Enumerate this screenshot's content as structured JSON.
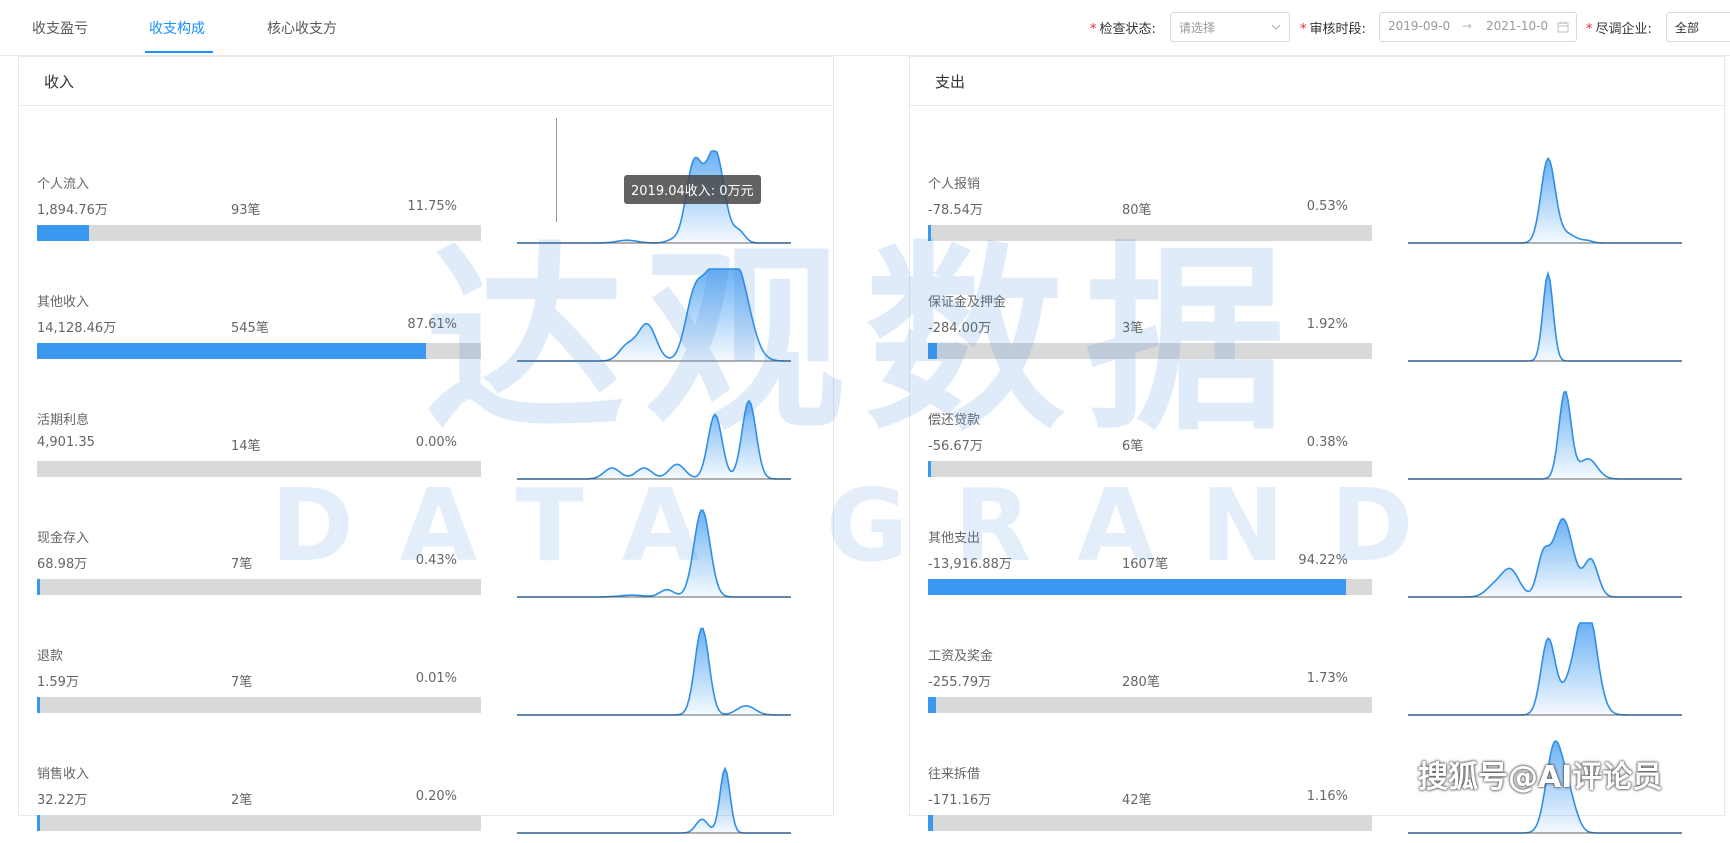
{
  "tabs": [
    {
      "label": "收支盈亏"
    },
    {
      "label": "收支构成"
    },
    {
      "label": "核心收支方"
    }
  ],
  "active_tab": 1,
  "filters": {
    "status_label": "检查状态:",
    "status_placeholder": "请选择",
    "period_label": "审核时段:",
    "date_start": "2019-09-0",
    "date_end": "2021-10-0",
    "date_separator": "→",
    "company_label": "尽调企业:",
    "company_value": "全部"
  },
  "income": {
    "title": "收入",
    "rows": [
      {
        "name": "个人流入",
        "amount": "1,894.76万",
        "count": "93笔",
        "percent": "11.75%",
        "ratio": 0.1175
      },
      {
        "name": "其他收入",
        "amount": "14,128.46万",
        "count": "545笔",
        "percent": "87.61%",
        "ratio": 0.8761
      },
      {
        "name": "活期利息",
        "amount": "4,901.35",
        "count": "14笔",
        "percent": "0.00%",
        "ratio": 0.0
      },
      {
        "name": "现金存入",
        "amount": "68.98万",
        "count": "7笔",
        "percent": "0.43%",
        "ratio": 0.0043
      },
      {
        "name": "退款",
        "amount": "1.59万",
        "count": "7笔",
        "percent": "0.01%",
        "ratio": 0.0001
      },
      {
        "name": "销售收入",
        "amount": "32.22万",
        "count": "2笔",
        "percent": "0.20%",
        "ratio": 0.002
      }
    ]
  },
  "expense": {
    "title": "支出",
    "rows": [
      {
        "name": "个人报销",
        "amount": "-78.54万",
        "count": "80笔",
        "percent": "0.53%",
        "ratio": 0.0053
      },
      {
        "name": "保证金及押金",
        "amount": "-284.00万",
        "count": "3笔",
        "percent": "1.92%",
        "ratio": 0.0192
      },
      {
        "name": "偿还贷款",
        "amount": "-56.67万",
        "count": "6笔",
        "percent": "0.38%",
        "ratio": 0.0038
      },
      {
        "name": "其他支出",
        "amount": "-13,916.88万",
        "count": "1607笔",
        "percent": "94.22%",
        "ratio": 0.9422
      },
      {
        "name": "工资及奖金",
        "amount": "-255.79万",
        "count": "280笔",
        "percent": "1.73%",
        "ratio": 0.0173
      },
      {
        "name": "往来拆借",
        "amount": "-171.16万",
        "count": "42笔",
        "percent": "1.16%",
        "ratio": 0.0116
      }
    ]
  },
  "tooltip": {
    "text": "2019.04收入: 0万元"
  },
  "watermark": {
    "text_cn": "达观数据",
    "text_en": "DATA GRAND"
  },
  "footer_watermark": {
    "text": "搜狐号@AI评论员"
  },
  "colors": {
    "accent": "#1890ff",
    "bar_fill": "#3a98f0",
    "bar_track": "#d9d9d9",
    "required": "#f5222d"
  }
}
